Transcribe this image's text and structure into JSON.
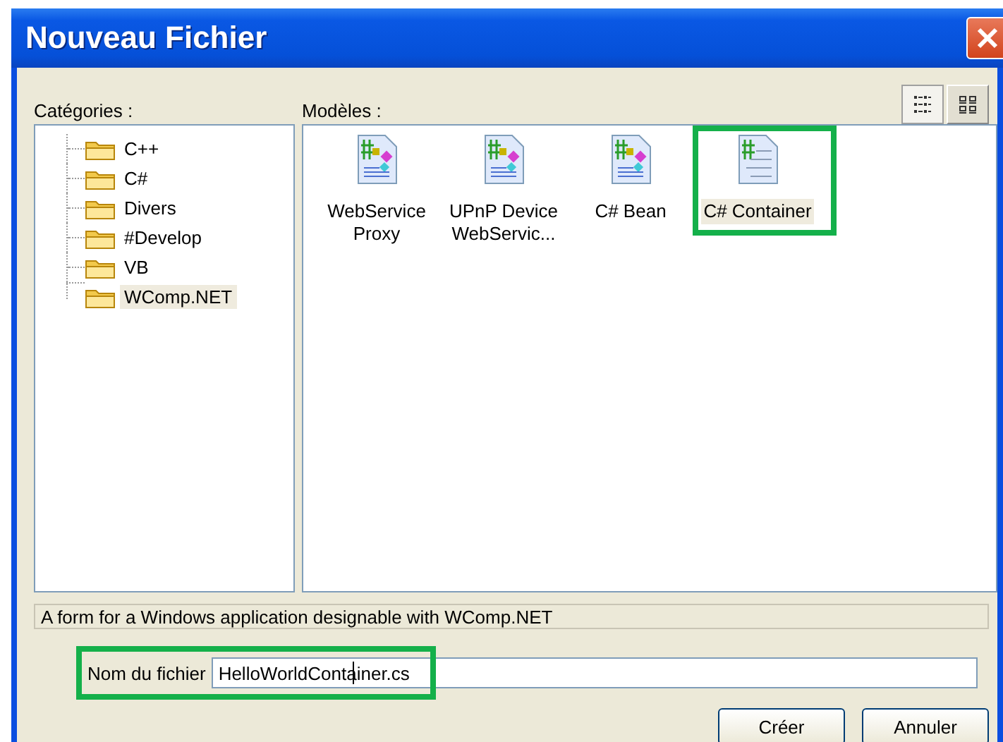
{
  "window": {
    "title": "Nouveau Fichier"
  },
  "categories": {
    "label": "Catégories :",
    "items": [
      {
        "label": "C++",
        "selected": false
      },
      {
        "label": "C#",
        "selected": false
      },
      {
        "label": "Divers",
        "selected": false
      },
      {
        "label": "#Develop",
        "selected": false
      },
      {
        "label": "VB",
        "selected": false
      },
      {
        "label": "WComp.NET",
        "selected": true
      }
    ]
  },
  "view_buttons": [
    {
      "kind": "list",
      "selected": false
    },
    {
      "kind": "large",
      "selected": true
    }
  ],
  "models": {
    "label": "Modèles :",
    "items": [
      {
        "label": "WebService Proxy",
        "kind": "component",
        "selected": false,
        "highlighted": false
      },
      {
        "label": "UPnP Device WebServic...",
        "kind": "component",
        "selected": false,
        "highlighted": false
      },
      {
        "label": "C# Bean",
        "kind": "component",
        "selected": false,
        "highlighted": false
      },
      {
        "label": "C# Container",
        "kind": "form",
        "selected": true,
        "highlighted": true
      }
    ]
  },
  "description": "A form for a Windows application designable with WComp.NET",
  "filename": {
    "label": "Nom du fichier",
    "value": "HelloWorldContainer.cs",
    "highlighted": true
  },
  "buttons": [
    "Créer",
    "Annuler"
  ]
}
